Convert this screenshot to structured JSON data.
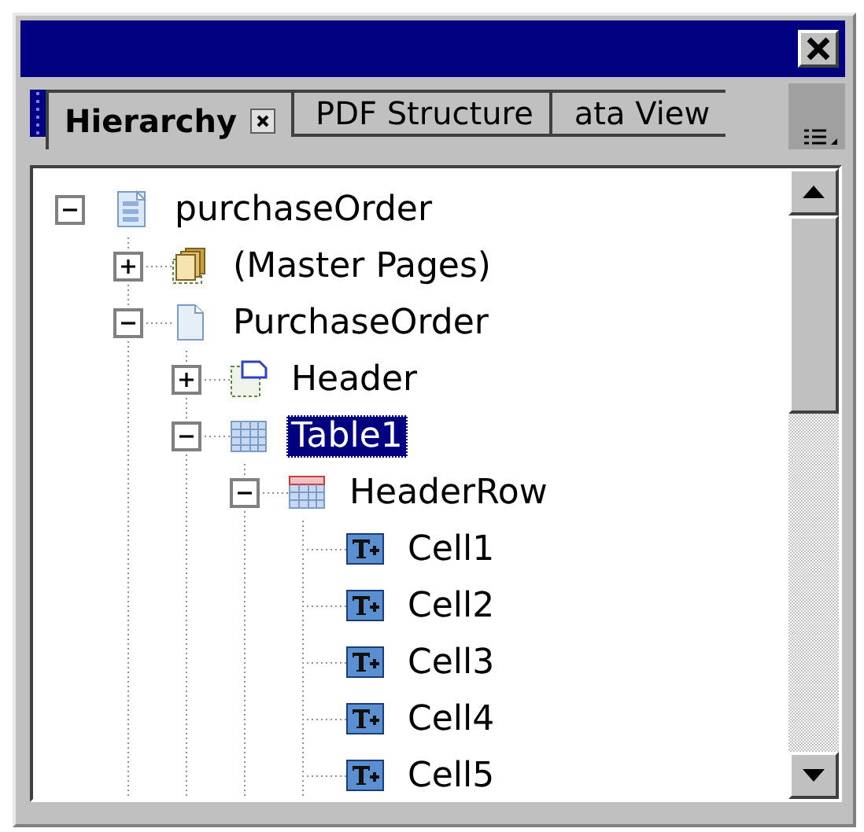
{
  "window": {
    "title_bar": {
      "has_close": true
    }
  },
  "tabs": [
    {
      "label": "Hierarchy",
      "selected": true,
      "closable": true
    },
    {
      "label": "PDF Structure",
      "selected": false
    },
    {
      "label": "ata View",
      "selected": false
    }
  ],
  "tree": [
    {
      "label": "purchaseOrder",
      "kind": "document",
      "expanded": true,
      "selected": false,
      "children": [
        {
          "label": "(Master Pages)",
          "kind": "master-pages",
          "expanded": false,
          "selected": false
        },
        {
          "label": "PurchaseOrder",
          "kind": "page",
          "expanded": true,
          "selected": false,
          "children": [
            {
              "label": "Header",
              "kind": "subform",
              "expanded": false,
              "selected": false
            },
            {
              "label": "Table1",
              "kind": "table",
              "expanded": true,
              "selected": true,
              "children": [
                {
                  "label": "HeaderRow",
                  "kind": "header-row",
                  "expanded": true,
                  "selected": false,
                  "children": [
                    {
                      "label": "Cell1",
                      "kind": "text-cell",
                      "selected": false
                    },
                    {
                      "label": "Cell2",
                      "kind": "text-cell",
                      "selected": false
                    },
                    {
                      "label": "Cell3",
                      "kind": "text-cell",
                      "selected": false
                    },
                    {
                      "label": "Cell4",
                      "kind": "text-cell",
                      "selected": false
                    },
                    {
                      "label": "Cell5",
                      "kind": "text-cell",
                      "selected": false
                    }
                  ]
                }
              ]
            }
          ]
        }
      ]
    }
  ]
}
